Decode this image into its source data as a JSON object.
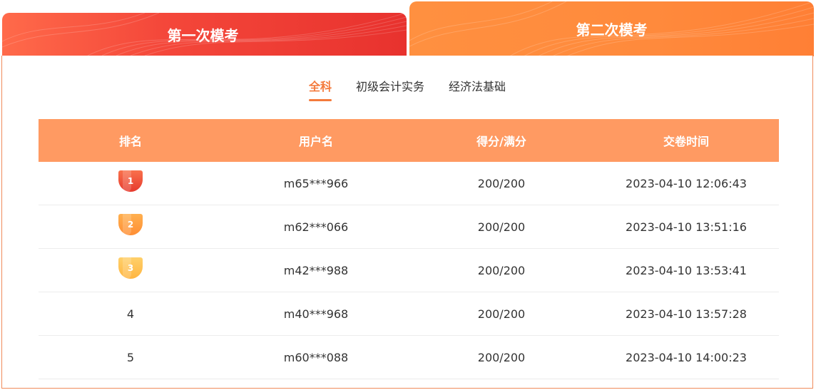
{
  "exam_tabs": [
    {
      "label": "第一次模考",
      "active": false
    },
    {
      "label": "第二次模考",
      "active": true
    }
  ],
  "subjects": [
    {
      "label": "全科",
      "active": true
    },
    {
      "label": "初级会计实务",
      "active": false
    },
    {
      "label": "经济法基础",
      "active": false
    }
  ],
  "table": {
    "headers": {
      "rank": "排名",
      "username": "用户名",
      "score": "得分/满分",
      "time": "交卷时间"
    },
    "rows": [
      {
        "rank": "1",
        "username": "m65***966",
        "score": "200/200",
        "time": "2023-04-10 12:06:43"
      },
      {
        "rank": "2",
        "username": "m62***066",
        "score": "200/200",
        "time": "2023-04-10 13:51:16"
      },
      {
        "rank": "3",
        "username": "m42***988",
        "score": "200/200",
        "time": "2023-04-10 13:53:41"
      },
      {
        "rank": "4",
        "username": "m40***968",
        "score": "200/200",
        "time": "2023-04-10 13:57:28"
      },
      {
        "rank": "5",
        "username": "m60***088",
        "score": "200/200",
        "time": "2023-04-10 14:00:23"
      }
    ]
  },
  "colors": {
    "accent": "#f47a3c",
    "header_bg": "#ff9a62",
    "tab1": "#e8322e",
    "tab2": "#ff8a3c"
  },
  "icons": {
    "rank_1": "medal-red-icon",
    "rank_2": "medal-orange-icon",
    "rank_3": "medal-yellow-icon"
  }
}
